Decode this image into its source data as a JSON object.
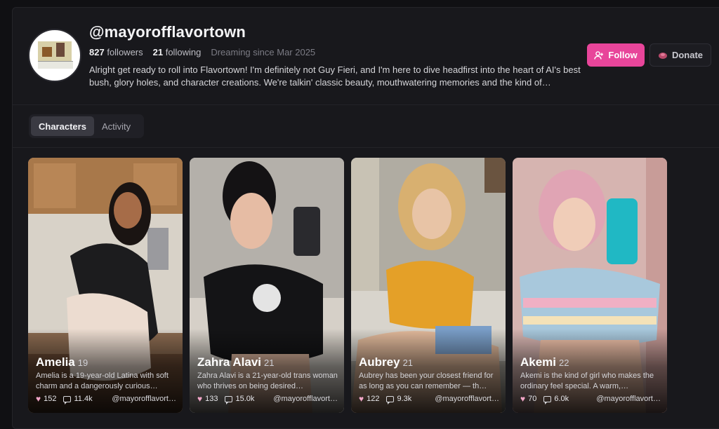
{
  "profile": {
    "username": "@mayorofflavortown",
    "followers_count": "827",
    "followers_label": "followers",
    "following_count": "21",
    "following_label": "following",
    "since": "Dreaming since Mar 2025",
    "bio": "Alright get ready to roll into Flavortown! I'm definitely not Guy Fieri, and I'm here to dive headfirst into the heart of AI's best bush, glory holes, and character creations. We're talkin' classic beauty, mouthwatering memories and the kind of…",
    "follow_label": "Follow",
    "donate_label": "Donate"
  },
  "tabs": [
    {
      "label": "Characters"
    },
    {
      "label": "Activity"
    }
  ],
  "cards": [
    {
      "name": "Amelia",
      "age": "19",
      "desc": "Amelia is a 19-year-old Latina with soft charm and a dangerously curious…",
      "likes": "152",
      "chats": "11.4k",
      "creator": "@mayorofflavort…"
    },
    {
      "name": "Zahra Alavi",
      "age": "21",
      "desc": "Zahra Alavi is a 21-year-old trans woman who thrives on being desired…",
      "likes": "133",
      "chats": "15.0k",
      "creator": "@mayorofflavort…"
    },
    {
      "name": "Aubrey",
      "age": "21",
      "desc": "Aubrey has been your closest friend for as long as you can remember — th…",
      "likes": "122",
      "chats": "9.3k",
      "creator": "@mayorofflavort…"
    },
    {
      "name": "Akemi",
      "age": "22",
      "desc": "Akemi is the kind of girl who makes the ordinary feel special. A warm,…",
      "likes": "70",
      "chats": "6.0k",
      "creator": "@mayorofflavort…"
    }
  ],
  "colors": {
    "accent": "#e8459a",
    "background": "#101013",
    "panel": "#18181c"
  },
  "icons": {
    "follow": "add-user-icon",
    "donate": "donate-icon",
    "like": "heart-icon",
    "chats": "chat-icon"
  }
}
